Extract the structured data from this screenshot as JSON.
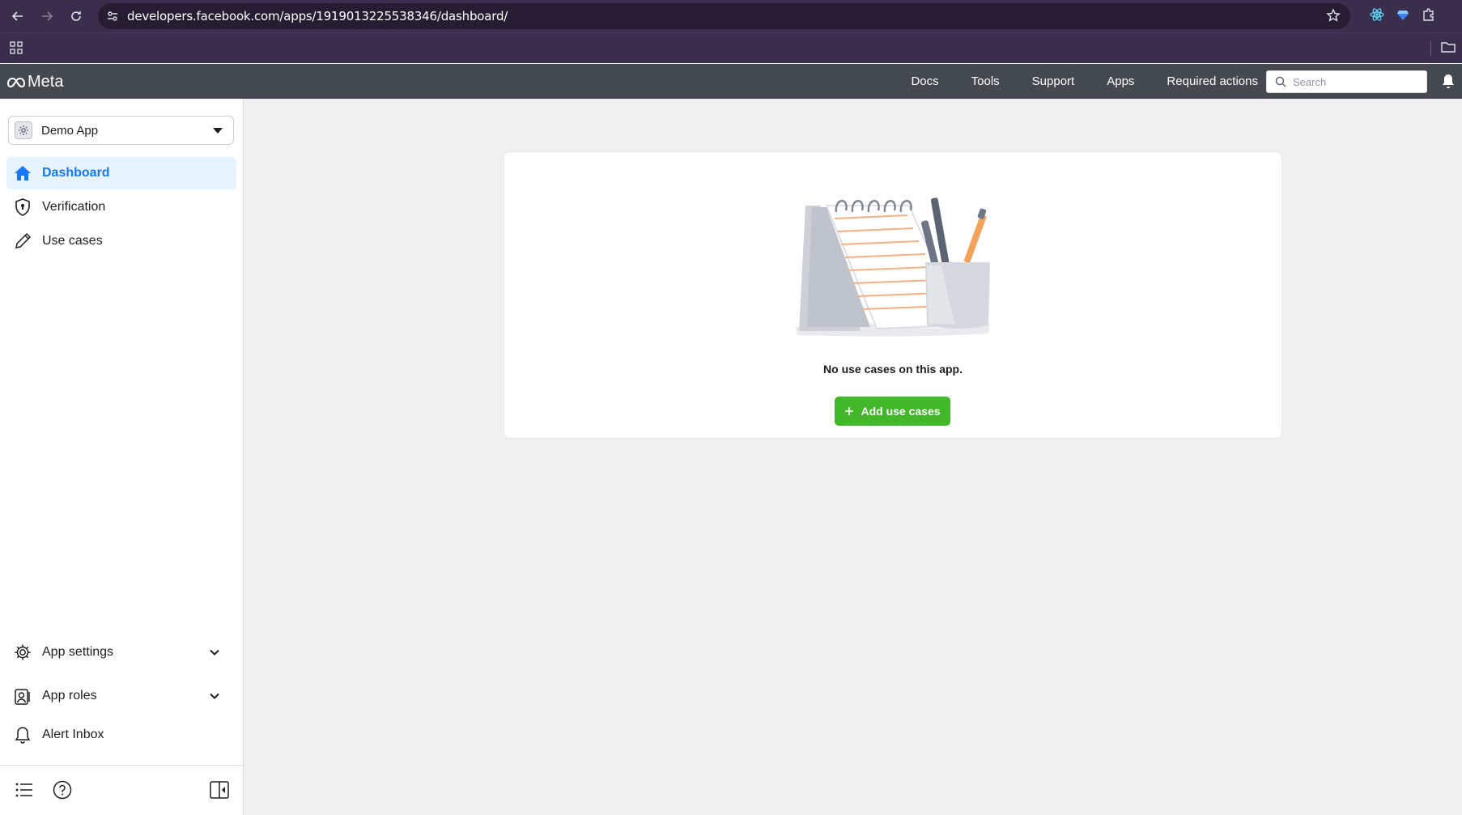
{
  "browser": {
    "url": "developers.facebook.com/apps/1919013225538346/dashboard/"
  },
  "header": {
    "logo_text": "Meta",
    "links": [
      "Docs",
      "Tools",
      "Support",
      "Apps",
      "Required actions"
    ],
    "search_placeholder": "Search"
  },
  "sidebar": {
    "app_name": "Demo App",
    "items": [
      {
        "label": "Dashboard",
        "icon": "home-icon",
        "active": true
      },
      {
        "label": "Verification",
        "icon": "shield-icon",
        "active": false
      },
      {
        "label": "Use cases",
        "icon": "pencil-icon",
        "active": false
      }
    ],
    "bottom_items": [
      {
        "label": "App settings",
        "icon": "gear-icon",
        "expandable": true
      },
      {
        "label": "App roles",
        "icon": "user-badge-icon",
        "expandable": true
      },
      {
        "label": "Alert Inbox",
        "icon": "bell-icon",
        "expandable": false
      }
    ]
  },
  "main": {
    "empty_message": "No use cases on this app.",
    "add_button_label": "Add use cases"
  },
  "colors": {
    "accent": "#1877f2",
    "primary_button": "#42b72a",
    "header_bg": "#444950"
  }
}
